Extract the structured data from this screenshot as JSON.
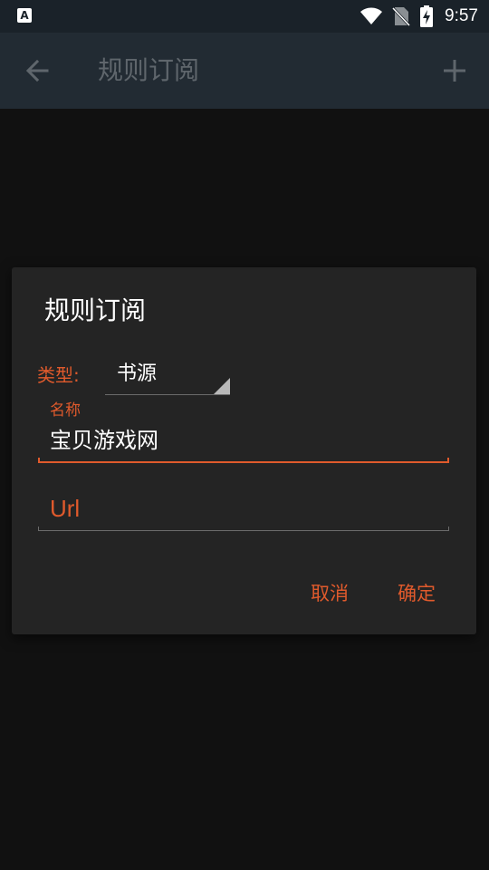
{
  "status_bar": {
    "app_icon": "A",
    "time": "9:57",
    "icons": [
      "wifi-icon",
      "no-sim-icon",
      "battery-charging-icon"
    ]
  },
  "toolbar": {
    "title": "规则订阅",
    "back_icon": "arrow-left-icon",
    "add_icon": "plus-icon"
  },
  "dialog": {
    "title": "规则订阅",
    "type_label": "类型:",
    "type_value": "书源",
    "name_label": "名称",
    "name_value": "宝贝游戏网",
    "url_placeholder": "Url",
    "cancel_label": "取消",
    "ok_label": "确定"
  },
  "colors": {
    "accent": "#e05a2c",
    "background": "#111111",
    "dialog_bg": "#242424",
    "toolbar_bg": "#222b33"
  }
}
